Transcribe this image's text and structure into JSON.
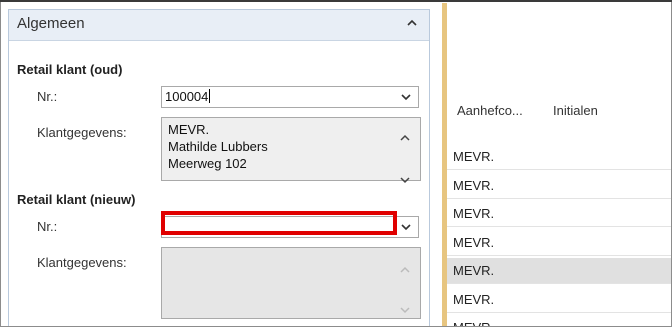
{
  "panel": {
    "title": "Algemeen"
  },
  "old_customer": {
    "section_title": "Retail klant (oud)",
    "nr_label": "Nr.:",
    "nr_value": "100004",
    "details_label": "Klantgegevens:",
    "details_lines": [
      "MEVR.",
      "Mathilde Lubbers",
      "Meerweg 102"
    ]
  },
  "new_customer": {
    "section_title": "Retail klant (nieuw)",
    "nr_label": "Nr.:",
    "nr_value": "",
    "details_label": "Klantgegevens:"
  },
  "grid": {
    "columns": [
      "Aanhefco...",
      "Initialen"
    ],
    "rows": [
      "MEVR.",
      "MEVR.",
      "MEVR.",
      "MEVR.",
      "MEVR.",
      "MEVR.",
      "MEVR."
    ],
    "selected_row_index": 4
  },
  "colors": {
    "highlight_border": "#e00000",
    "splitter": "#e7c580",
    "panel_header": "#e8eef6"
  }
}
